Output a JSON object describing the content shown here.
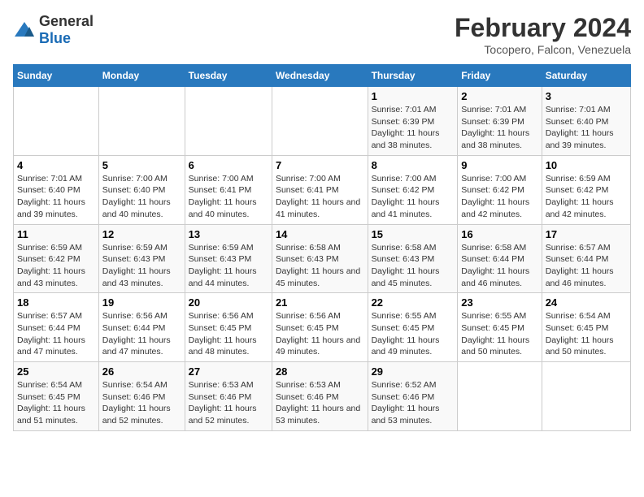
{
  "logo": {
    "general": "General",
    "blue": "Blue"
  },
  "title": "February 2024",
  "subtitle": "Tocopero, Falcon, Venezuela",
  "headers": [
    "Sunday",
    "Monday",
    "Tuesday",
    "Wednesday",
    "Thursday",
    "Friday",
    "Saturday"
  ],
  "weeks": [
    [
      {
        "day": "",
        "sunrise": "",
        "sunset": "",
        "daylight": ""
      },
      {
        "day": "",
        "sunrise": "",
        "sunset": "",
        "daylight": ""
      },
      {
        "day": "",
        "sunrise": "",
        "sunset": "",
        "daylight": ""
      },
      {
        "day": "",
        "sunrise": "",
        "sunset": "",
        "daylight": ""
      },
      {
        "day": "1",
        "sunrise": "Sunrise: 7:01 AM",
        "sunset": "Sunset: 6:39 PM",
        "daylight": "Daylight: 11 hours and 38 minutes."
      },
      {
        "day": "2",
        "sunrise": "Sunrise: 7:01 AM",
        "sunset": "Sunset: 6:39 PM",
        "daylight": "Daylight: 11 hours and 38 minutes."
      },
      {
        "day": "3",
        "sunrise": "Sunrise: 7:01 AM",
        "sunset": "Sunset: 6:40 PM",
        "daylight": "Daylight: 11 hours and 39 minutes."
      }
    ],
    [
      {
        "day": "4",
        "sunrise": "Sunrise: 7:01 AM",
        "sunset": "Sunset: 6:40 PM",
        "daylight": "Daylight: 11 hours and 39 minutes."
      },
      {
        "day": "5",
        "sunrise": "Sunrise: 7:00 AM",
        "sunset": "Sunset: 6:40 PM",
        "daylight": "Daylight: 11 hours and 40 minutes."
      },
      {
        "day": "6",
        "sunrise": "Sunrise: 7:00 AM",
        "sunset": "Sunset: 6:41 PM",
        "daylight": "Daylight: 11 hours and 40 minutes."
      },
      {
        "day": "7",
        "sunrise": "Sunrise: 7:00 AM",
        "sunset": "Sunset: 6:41 PM",
        "daylight": "Daylight: 11 hours and 41 minutes."
      },
      {
        "day": "8",
        "sunrise": "Sunrise: 7:00 AM",
        "sunset": "Sunset: 6:42 PM",
        "daylight": "Daylight: 11 hours and 41 minutes."
      },
      {
        "day": "9",
        "sunrise": "Sunrise: 7:00 AM",
        "sunset": "Sunset: 6:42 PM",
        "daylight": "Daylight: 11 hours and 42 minutes."
      },
      {
        "day": "10",
        "sunrise": "Sunrise: 6:59 AM",
        "sunset": "Sunset: 6:42 PM",
        "daylight": "Daylight: 11 hours and 42 minutes."
      }
    ],
    [
      {
        "day": "11",
        "sunrise": "Sunrise: 6:59 AM",
        "sunset": "Sunset: 6:42 PM",
        "daylight": "Daylight: 11 hours and 43 minutes."
      },
      {
        "day": "12",
        "sunrise": "Sunrise: 6:59 AM",
        "sunset": "Sunset: 6:43 PM",
        "daylight": "Daylight: 11 hours and 43 minutes."
      },
      {
        "day": "13",
        "sunrise": "Sunrise: 6:59 AM",
        "sunset": "Sunset: 6:43 PM",
        "daylight": "Daylight: 11 hours and 44 minutes."
      },
      {
        "day": "14",
        "sunrise": "Sunrise: 6:58 AM",
        "sunset": "Sunset: 6:43 PM",
        "daylight": "Daylight: 11 hours and 45 minutes."
      },
      {
        "day": "15",
        "sunrise": "Sunrise: 6:58 AM",
        "sunset": "Sunset: 6:43 PM",
        "daylight": "Daylight: 11 hours and 45 minutes."
      },
      {
        "day": "16",
        "sunrise": "Sunrise: 6:58 AM",
        "sunset": "Sunset: 6:44 PM",
        "daylight": "Daylight: 11 hours and 46 minutes."
      },
      {
        "day": "17",
        "sunrise": "Sunrise: 6:57 AM",
        "sunset": "Sunset: 6:44 PM",
        "daylight": "Daylight: 11 hours and 46 minutes."
      }
    ],
    [
      {
        "day": "18",
        "sunrise": "Sunrise: 6:57 AM",
        "sunset": "Sunset: 6:44 PM",
        "daylight": "Daylight: 11 hours and 47 minutes."
      },
      {
        "day": "19",
        "sunrise": "Sunrise: 6:56 AM",
        "sunset": "Sunset: 6:44 PM",
        "daylight": "Daylight: 11 hours and 47 minutes."
      },
      {
        "day": "20",
        "sunrise": "Sunrise: 6:56 AM",
        "sunset": "Sunset: 6:45 PM",
        "daylight": "Daylight: 11 hours and 48 minutes."
      },
      {
        "day": "21",
        "sunrise": "Sunrise: 6:56 AM",
        "sunset": "Sunset: 6:45 PM",
        "daylight": "Daylight: 11 hours and 49 minutes."
      },
      {
        "day": "22",
        "sunrise": "Sunrise: 6:55 AM",
        "sunset": "Sunset: 6:45 PM",
        "daylight": "Daylight: 11 hours and 49 minutes."
      },
      {
        "day": "23",
        "sunrise": "Sunrise: 6:55 AM",
        "sunset": "Sunset: 6:45 PM",
        "daylight": "Daylight: 11 hours and 50 minutes."
      },
      {
        "day": "24",
        "sunrise": "Sunrise: 6:54 AM",
        "sunset": "Sunset: 6:45 PM",
        "daylight": "Daylight: 11 hours and 50 minutes."
      }
    ],
    [
      {
        "day": "25",
        "sunrise": "Sunrise: 6:54 AM",
        "sunset": "Sunset: 6:45 PM",
        "daylight": "Daylight: 11 hours and 51 minutes."
      },
      {
        "day": "26",
        "sunrise": "Sunrise: 6:54 AM",
        "sunset": "Sunset: 6:46 PM",
        "daylight": "Daylight: 11 hours and 52 minutes."
      },
      {
        "day": "27",
        "sunrise": "Sunrise: 6:53 AM",
        "sunset": "Sunset: 6:46 PM",
        "daylight": "Daylight: 11 hours and 52 minutes."
      },
      {
        "day": "28",
        "sunrise": "Sunrise: 6:53 AM",
        "sunset": "Sunset: 6:46 PM",
        "daylight": "Daylight: 11 hours and 53 minutes."
      },
      {
        "day": "29",
        "sunrise": "Sunrise: 6:52 AM",
        "sunset": "Sunset: 6:46 PM",
        "daylight": "Daylight: 11 hours and 53 minutes."
      },
      {
        "day": "",
        "sunrise": "",
        "sunset": "",
        "daylight": ""
      },
      {
        "day": "",
        "sunrise": "",
        "sunset": "",
        "daylight": ""
      }
    ]
  ]
}
